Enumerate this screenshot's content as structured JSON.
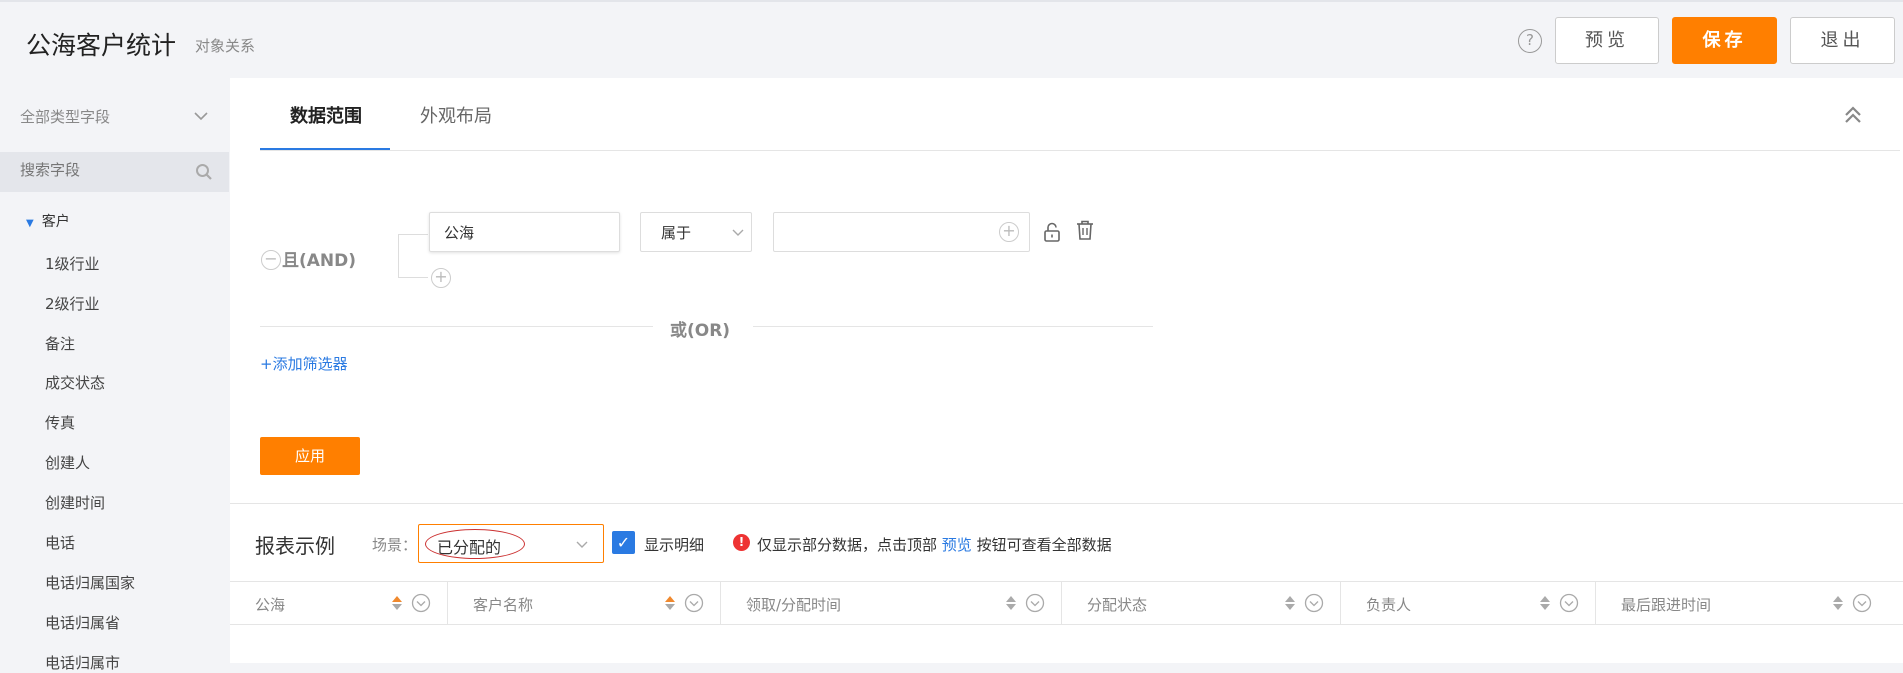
{
  "header": {
    "title": "公海客户统计",
    "subtitle": "对象关系",
    "help": "?",
    "preview_label": "预览",
    "save_label": "保存",
    "exit_label": "退出"
  },
  "sidebar": {
    "type_select": "全部类型字段",
    "search_placeholder": "搜索字段",
    "root_label": "客户",
    "items": [
      "1级行业",
      "2级行业",
      "备注",
      "成交状态",
      "传真",
      "创建人",
      "创建时间",
      "电话",
      "电话归属国家",
      "电话归属省",
      "电话归属市"
    ]
  },
  "tabs": {
    "data_range": "数据范围",
    "appearance": "外观布局"
  },
  "filter": {
    "and_label": "且(AND)",
    "field_value": "公海",
    "operator": "属于",
    "value": "",
    "or_label": "或(OR)",
    "add_filter": "+添加筛选器",
    "apply_label": "应用"
  },
  "report": {
    "title": "报表示例",
    "scene_label": "场景：",
    "scene_value": "已分配的",
    "show_detail_label": "显示明细",
    "show_detail_checked": true,
    "warning_before": "仅显示部分数据，点击顶部 ",
    "warning_link": "预览",
    "warning_after": " 按钮可查看全部数据",
    "columns": [
      "公海",
      "客户名称",
      "领取/分配时间",
      "分配状态",
      "负责人",
      "最后跟进时间"
    ],
    "sorted_columns": [
      0,
      1
    ]
  },
  "colors": {
    "accent": "#ff7f00",
    "link": "#2a7ae2",
    "warning": "#e33333"
  }
}
